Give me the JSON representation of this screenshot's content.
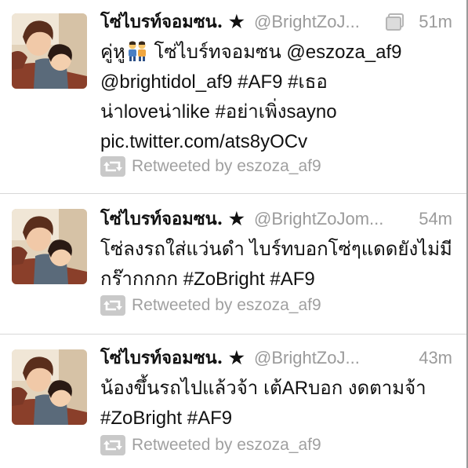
{
  "tweets": [
    {
      "name": "โซ่ไบรท์จอมซน. ★",
      "handle": "@BrightZoJ...",
      "time": "51m",
      "has_media": true,
      "lines": [
        "คู่หู",
        "@brightidol_af9 #AF9 #เธอ",
        "น่าloveน่าlike #อย่าเพิ่งsayno",
        "pic.twitter.com/ats8yOCv"
      ],
      "line1_suffix": " โซ่ไบร์ทจอมซน @eszoza_af9",
      "retweet": "Retweeted by eszoza_af9"
    },
    {
      "name": "โซ่ไบรท์จอมซน. ★",
      "handle": "@BrightZoJom...",
      "time": "54m",
      "has_media": false,
      "lines": [
        "โซ่ลงรถใส่แว่นดำ ไบร์ทบอกโซ่ๆแดดยังไม่มี",
        "กร๊ากกกก #ZoBright #AF9"
      ],
      "retweet": "Retweeted by eszoza_af9"
    },
    {
      "name": "โซ่ไบรท์จอมซน. ★",
      "handle": "@BrightZoJ...",
      "time": "43m",
      "has_media": false,
      "lines": [
        "น้องขึ้นรถไปแล้วจ้า เต้ARบอก งดตามจ้า",
        "#ZoBright #AF9"
      ],
      "retweet": "Retweeted by eszoza_af9"
    }
  ],
  "colors": {
    "name": "#111111",
    "meta": "#9b9b9b",
    "body": "#111111",
    "divider": "#d8d8d8"
  },
  "icons": {
    "avatar": "profile-photo",
    "media": "media-attachment-icon",
    "retweet": "retweet-icon",
    "emoji": "couple-emoji"
  }
}
